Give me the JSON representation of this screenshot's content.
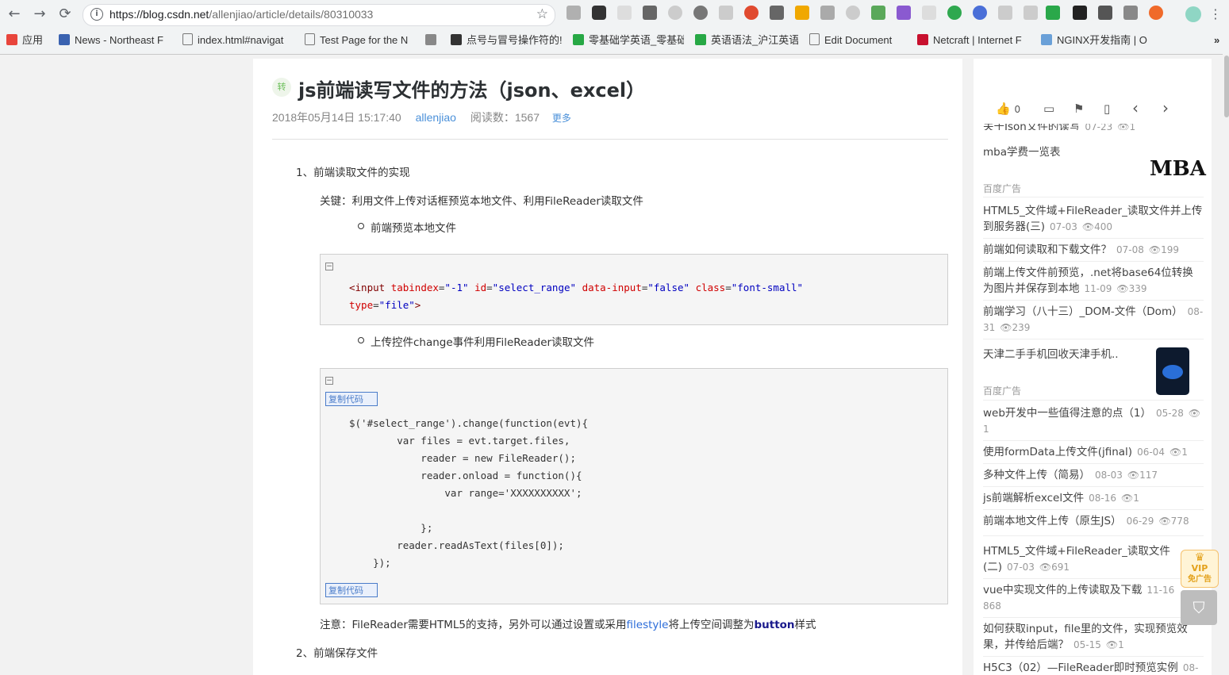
{
  "browser": {
    "url_host": "https://blog.csdn.net",
    "url_path": "/allenjiao/article/details/80310033",
    "bookmarks": [
      {
        "label": "应用"
      },
      {
        "label": "News - Northeast F"
      },
      {
        "label": "index.html#navigat"
      },
      {
        "label": "Test Page for the N"
      },
      {
        "label": ""
      },
      {
        "label": "点号与冒号操作符的!"
      },
      {
        "label": "零基础学英语_零基础"
      },
      {
        "label": "英语语法_沪江英语"
      },
      {
        "label": "Edit Document"
      },
      {
        "label": "Netcraft | Internet F"
      },
      {
        "label": "NGINX开发指南 | O"
      }
    ],
    "more_bookmarks": "»"
  },
  "article": {
    "repost_badge": "转",
    "title": "js前端读写文件的方法（json、excel）",
    "date": "2018年05月14日 15:17:40",
    "author": "allenjiao",
    "reads": "阅读数：1567",
    "more": "更多",
    "section1": "1、前端读取文件的实现",
    "key_note": "关键：利用文件上传对话框预览本地文件、利用FileReader读取文件",
    "bullet1": "前端预览本地文件",
    "code1_line1": {
      "open": "<input",
      "a1": "tabindex",
      "v1": "\"-1\"",
      "a2": "id",
      "v2": "\"select_range\"",
      "a3": "data-input",
      "v3": "\"false\"",
      "a4": "class",
      "v4": "\"font-small\""
    },
    "code1_line2": {
      "a5": "type",
      "v5": "\"file\"",
      "close": ">"
    },
    "bullet2": "上传控件change事件利用FileReader读取文件",
    "copy_label": "复制代码",
    "code2": [
      "$('#select_range').change(function(evt){",
      "        var files = evt.target.files,",
      "            reader = new FileReader();",
      "            reader.onload = function(){",
      "                var range='XXXXXXXXXX';",
      "",
      "            };",
      "        reader.readAsText(files[0]);",
      "    });"
    ],
    "note_prefix": "注意：FileReader需要HTML5的支持，另外可以通过设置或采用",
    "note_link": "filestyle",
    "note_mid": "将上传空间调整为",
    "note_bold": "button",
    "note_suffix": "样式",
    "section2": "2、前端保存文件"
  },
  "sidebar": {
    "like_count": "0",
    "items": [
      {
        "title": "关于Json文件的读写",
        "date": "07-23",
        "views": "1"
      },
      {
        "title": "mba学费一览表",
        "date": "",
        "views": ""
      },
      {
        "title": "HTML5_文件域+FileReader_读取文件并上传到服务器(三)",
        "date": "07-03",
        "views": "400"
      },
      {
        "title": "前端如何读取和下载文件？",
        "date": "07-08",
        "views": "199"
      },
      {
        "title": "前端上传文件前预览，.net将base64位转换为图片并保存到本地",
        "date": "11-09",
        "views": "339"
      },
      {
        "title": "前端学习（八十三）_DOM-文件（Dom）",
        "date": "08-31",
        "views": "239"
      },
      {
        "title": "天津二手手机回收天津手机..",
        "date": "",
        "views": ""
      },
      {
        "title": "web开发中一些值得注意的点（1）",
        "date": "05-28",
        "views": "1"
      },
      {
        "title": "使用formData上传文件(jfinal)",
        "date": "06-04",
        "views": "1"
      },
      {
        "title": "多种文件上传（简易）",
        "date": "08-03",
        "views": "117"
      },
      {
        "title": "js前端解析excel文件",
        "date": "08-16",
        "views": "1"
      },
      {
        "title": "前端本地文件上传（原生JS）",
        "date": "06-29",
        "views": "778"
      },
      {
        "title": "HTML5_文件域+FileReader_读取文件(二)",
        "date": "07-03",
        "views": "691"
      },
      {
        "title": "vue中实现文件的上传读取及下载",
        "date": "11-16",
        "views": "868"
      },
      {
        "title": "如何获取input，file里的文件，实现预览效果，并传给后端？",
        "date": "05-15",
        "views": "1"
      },
      {
        "title": "H5C3（02）—FileReader即时预览实例",
        "date": "08-",
        "views": ""
      }
    ],
    "ad_label": "百度广告",
    "mba_logo": "MBA"
  },
  "float": {
    "vip_line1": "VIP",
    "vip_line2": "免广告"
  }
}
